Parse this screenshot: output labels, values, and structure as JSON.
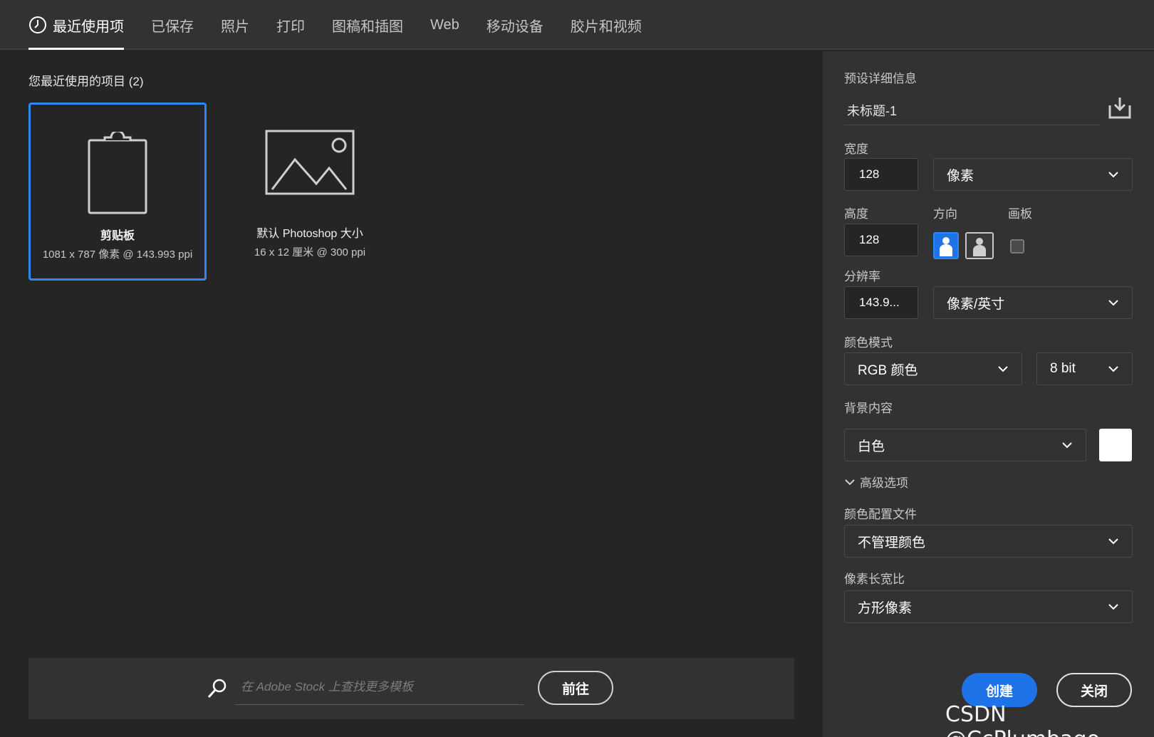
{
  "tabs": [
    {
      "label": "最近使用项",
      "active": true,
      "icon": "clock-icon"
    },
    {
      "label": "已保存"
    },
    {
      "label": "照片"
    },
    {
      "label": "打印"
    },
    {
      "label": "图稿和插图"
    },
    {
      "label": "Web"
    },
    {
      "label": "移动设备"
    },
    {
      "label": "胶片和视频"
    }
  ],
  "recent": {
    "title": "您最近使用的项目 (2)",
    "items": [
      {
        "name": "剪贴板",
        "meta": "1081 x 787 像素 @ 143.993 ppi",
        "icon": "clipboard-icon",
        "selected": true
      },
      {
        "name": "默认 Photoshop 大小",
        "meta": "16 x 12 厘米 @ 300 ppi",
        "icon": "image-icon",
        "selected": false
      }
    ]
  },
  "stock": {
    "placeholder": "在 Adobe Stock 上查找更多模板",
    "go_label": "前往"
  },
  "preset": {
    "title": "预设详细信息",
    "doc_name": "未标题-1",
    "width_label": "宽度",
    "width_value": "128",
    "width_unit": "像素",
    "height_label": "高度",
    "height_value": "128",
    "orientation_label": "方向",
    "artboard_label": "画板",
    "resolution_label": "分辨率",
    "resolution_value": "143.9...",
    "resolution_unit": "像素/英寸",
    "color_mode_label": "颜色模式",
    "color_mode": "RGB 颜色",
    "bit_depth": "8 bit",
    "background_label": "背景内容",
    "background": "白色",
    "background_color": "#ffffff",
    "advanced_label": "高级选项",
    "color_profile_label": "颜色配置文件",
    "color_profile": "不管理颜色",
    "pixel_aspect_label": "像素长宽比",
    "pixel_aspect": "方形像素",
    "create_label": "创建",
    "close_label": "关闭"
  },
  "colors": {
    "accent": "#1f73e8",
    "selection_border": "#2f86f0",
    "panel": "#323232",
    "background": "#252525"
  },
  "watermark": "CSDN @CcPlumbago"
}
